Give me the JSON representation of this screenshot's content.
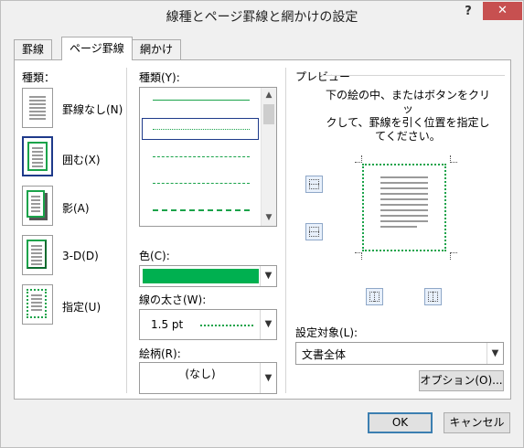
{
  "window": {
    "title": "線種とページ罫線と網かけの設定",
    "help_label": "?",
    "close_label": "✕"
  },
  "tabs": [
    {
      "label": "罫線",
      "active": false
    },
    {
      "label": "ページ罫線",
      "active": true
    },
    {
      "label": "網かけ",
      "active": false
    }
  ],
  "settings": {
    "label": "種類：",
    "items": [
      {
        "label": "罫線なし(N)",
        "selected": false
      },
      {
        "label": "囲む(X)",
        "selected": true
      },
      {
        "label": "影(A)",
        "selected": false
      },
      {
        "label": "3-D(D)",
        "selected": false
      },
      {
        "label": "指定(U)",
        "selected": false
      }
    ]
  },
  "style": {
    "label": "種類(Y):",
    "selected_index": 1,
    "color_label": "色(C):",
    "color_value": "#00b050",
    "width_label": "線の太さ(W):",
    "width_value": "1.5 pt",
    "art_label": "絵柄(R):",
    "art_value": "(なし)",
    "scroll_up": "▲",
    "scroll_down": "▼",
    "dropdown": "▼"
  },
  "preview": {
    "label": "プレビュー",
    "instructions": [
      "下の絵の中、またはボタンをクリッ",
      "クして、罫線を引く位置を指定し",
      "てください。"
    ],
    "apply_label": "設定対象(L):",
    "apply_value": "文書全体",
    "options_label": "オプション(O)..."
  },
  "footer": {
    "ok_label": "OK",
    "cancel_label": "キャンセル"
  },
  "colors": {
    "line_color": "#00b050",
    "selection": "#1e3a8a"
  }
}
